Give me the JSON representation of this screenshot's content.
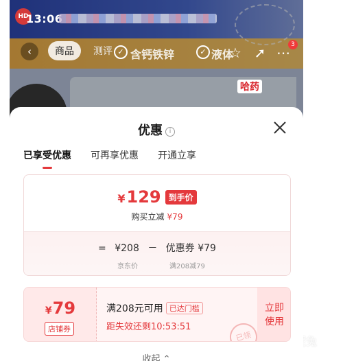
{
  "status_bar": {
    "time": "13:06"
  },
  "background_page": {
    "nav_tabs": [
      "商品",
      "测评"
    ],
    "highlights": [
      "含钙铁锌",
      "液体"
    ],
    "brand_label": "哈药",
    "cart_count": "3",
    "logo_text": "HD"
  },
  "sheet": {
    "title": "优惠",
    "tabs": [
      "已享受优惠",
      "可再享优惠",
      "开通立享"
    ],
    "active_tab": "已享受优惠",
    "price_card": {
      "currency": "¥",
      "final_price": "129",
      "final_price_tag": "到手价",
      "reduce_label": "购买立减",
      "reduce_amount": "¥79",
      "formula_equals": "=",
      "formula_base": "¥208",
      "formula_minus": "－",
      "formula_coupon": "优惠券 ¥79",
      "label_base": "京东价",
      "label_coupon": "满208减79"
    },
    "coupon": {
      "currency": "¥",
      "value": "79",
      "type": "店铺券",
      "condition": "满208元可用",
      "badge": "已达门槛",
      "expire": "距失效还剩10:53:51",
      "action_line1": "立即",
      "action_line2": "使用",
      "stamp": "已领"
    },
    "collapse_label": "收起"
  },
  "watermark": "可妮兔",
  "colors": {
    "accent": "#e4393c",
    "banner": "#2f49b3",
    "highlight_strip": "#f2b24a"
  },
  "icons": [
    "info-icon",
    "close-icon",
    "back-icon",
    "star-icon",
    "share-icon",
    "check-icon",
    "chevron-up-icon"
  ]
}
